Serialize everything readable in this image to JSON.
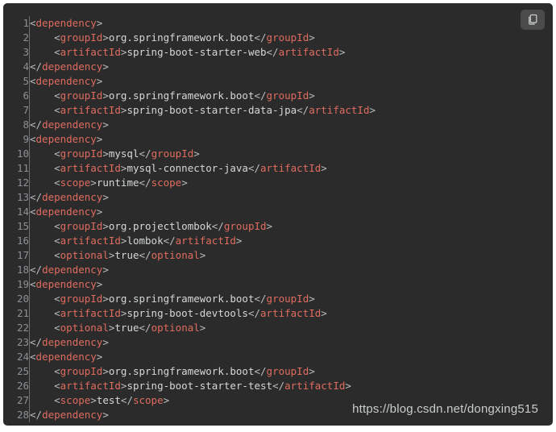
{
  "card": {
    "background_color": "#2b2b2b",
    "gutter_text_color": "#8c9196",
    "tag_color": "#e06c5f",
    "punctuation_color": "#b9bdc0",
    "text_color": "#d4d7d9"
  },
  "copy_button": {
    "label": "",
    "icon": "copy-icon",
    "title": "copy"
  },
  "watermark": {
    "text": "https://blog.csdn.net/dongxing515"
  },
  "code": {
    "language": "xml",
    "lines": [
      {
        "n": "1",
        "indent": 0,
        "tokens": [
          {
            "t": "p",
            "v": "<"
          },
          {
            "t": "tag",
            "v": "dependency"
          },
          {
            "t": "p",
            "v": ">"
          }
        ]
      },
      {
        "n": "2",
        "indent": 1,
        "tokens": [
          {
            "t": "p",
            "v": "<"
          },
          {
            "t": "tag",
            "v": "groupId"
          },
          {
            "t": "p",
            "v": ">"
          },
          {
            "t": "txt",
            "v": "org.springframework.boot"
          },
          {
            "t": "p",
            "v": "</"
          },
          {
            "t": "tag",
            "v": "groupId"
          },
          {
            "t": "p",
            "v": ">"
          }
        ]
      },
      {
        "n": "3",
        "indent": 1,
        "tokens": [
          {
            "t": "p",
            "v": "<"
          },
          {
            "t": "tag",
            "v": "artifactId"
          },
          {
            "t": "p",
            "v": ">"
          },
          {
            "t": "txt",
            "v": "spring-boot-starter-web"
          },
          {
            "t": "p",
            "v": "</"
          },
          {
            "t": "tag",
            "v": "artifactId"
          },
          {
            "t": "p",
            "v": ">"
          }
        ]
      },
      {
        "n": "4",
        "indent": 0,
        "tokens": [
          {
            "t": "p",
            "v": "</"
          },
          {
            "t": "tag",
            "v": "dependency"
          },
          {
            "t": "p",
            "v": ">"
          }
        ]
      },
      {
        "n": "5",
        "indent": 0,
        "tokens": [
          {
            "t": "p",
            "v": "<"
          },
          {
            "t": "tag",
            "v": "dependency"
          },
          {
            "t": "p",
            "v": ">"
          }
        ]
      },
      {
        "n": "6",
        "indent": 1,
        "tokens": [
          {
            "t": "p",
            "v": "<"
          },
          {
            "t": "tag",
            "v": "groupId"
          },
          {
            "t": "p",
            "v": ">"
          },
          {
            "t": "txt",
            "v": "org.springframework.boot"
          },
          {
            "t": "p",
            "v": "</"
          },
          {
            "t": "tag",
            "v": "groupId"
          },
          {
            "t": "p",
            "v": ">"
          }
        ]
      },
      {
        "n": "7",
        "indent": 1,
        "tokens": [
          {
            "t": "p",
            "v": "<"
          },
          {
            "t": "tag",
            "v": "artifactId"
          },
          {
            "t": "p",
            "v": ">"
          },
          {
            "t": "txt",
            "v": "spring-boot-starter-data-jpa"
          },
          {
            "t": "p",
            "v": "</"
          },
          {
            "t": "tag",
            "v": "artifactId"
          },
          {
            "t": "p",
            "v": ">"
          }
        ]
      },
      {
        "n": "8",
        "indent": 0,
        "tokens": [
          {
            "t": "p",
            "v": "</"
          },
          {
            "t": "tag",
            "v": "dependency"
          },
          {
            "t": "p",
            "v": ">"
          }
        ]
      },
      {
        "n": "9",
        "indent": 0,
        "tokens": [
          {
            "t": "p",
            "v": "<"
          },
          {
            "t": "tag",
            "v": "dependency"
          },
          {
            "t": "p",
            "v": ">"
          }
        ]
      },
      {
        "n": "10",
        "indent": 1,
        "tokens": [
          {
            "t": "p",
            "v": "<"
          },
          {
            "t": "tag",
            "v": "groupId"
          },
          {
            "t": "p",
            "v": ">"
          },
          {
            "t": "txt",
            "v": "mysql"
          },
          {
            "t": "p",
            "v": "</"
          },
          {
            "t": "tag",
            "v": "groupId"
          },
          {
            "t": "p",
            "v": ">"
          }
        ]
      },
      {
        "n": "11",
        "indent": 1,
        "tokens": [
          {
            "t": "p",
            "v": "<"
          },
          {
            "t": "tag",
            "v": "artifactId"
          },
          {
            "t": "p",
            "v": ">"
          },
          {
            "t": "txt",
            "v": "mysql-connector-java"
          },
          {
            "t": "p",
            "v": "</"
          },
          {
            "t": "tag",
            "v": "artifactId"
          },
          {
            "t": "p",
            "v": ">"
          }
        ]
      },
      {
        "n": "12",
        "indent": 1,
        "tokens": [
          {
            "t": "p",
            "v": "<"
          },
          {
            "t": "tag",
            "v": "scope"
          },
          {
            "t": "p",
            "v": ">"
          },
          {
            "t": "txt",
            "v": "runtime"
          },
          {
            "t": "p",
            "v": "</"
          },
          {
            "t": "tag",
            "v": "scope"
          },
          {
            "t": "p",
            "v": ">"
          }
        ]
      },
      {
        "n": "13",
        "indent": 0,
        "tokens": [
          {
            "t": "p",
            "v": "</"
          },
          {
            "t": "tag",
            "v": "dependency"
          },
          {
            "t": "p",
            "v": ">"
          }
        ]
      },
      {
        "n": "14",
        "indent": 0,
        "tokens": [
          {
            "t": "p",
            "v": "<"
          },
          {
            "t": "tag",
            "v": "dependency"
          },
          {
            "t": "p",
            "v": ">"
          }
        ]
      },
      {
        "n": "15",
        "indent": 1,
        "tokens": [
          {
            "t": "p",
            "v": "<"
          },
          {
            "t": "tag",
            "v": "groupId"
          },
          {
            "t": "p",
            "v": ">"
          },
          {
            "t": "txt",
            "v": "org.projectlombok"
          },
          {
            "t": "p",
            "v": "</"
          },
          {
            "t": "tag",
            "v": "groupId"
          },
          {
            "t": "p",
            "v": ">"
          }
        ]
      },
      {
        "n": "16",
        "indent": 1,
        "tokens": [
          {
            "t": "p",
            "v": "<"
          },
          {
            "t": "tag",
            "v": "artifactId"
          },
          {
            "t": "p",
            "v": ">"
          },
          {
            "t": "txt",
            "v": "lombok"
          },
          {
            "t": "p",
            "v": "</"
          },
          {
            "t": "tag",
            "v": "artifactId"
          },
          {
            "t": "p",
            "v": ">"
          }
        ]
      },
      {
        "n": "17",
        "indent": 1,
        "tokens": [
          {
            "t": "p",
            "v": "<"
          },
          {
            "t": "tag",
            "v": "optional"
          },
          {
            "t": "p",
            "v": ">"
          },
          {
            "t": "txt",
            "v": "true"
          },
          {
            "t": "p",
            "v": "</"
          },
          {
            "t": "tag",
            "v": "optional"
          },
          {
            "t": "p",
            "v": ">"
          }
        ]
      },
      {
        "n": "18",
        "indent": 0,
        "tokens": [
          {
            "t": "p",
            "v": "</"
          },
          {
            "t": "tag",
            "v": "dependency"
          },
          {
            "t": "p",
            "v": ">"
          }
        ]
      },
      {
        "n": "19",
        "indent": 0,
        "tokens": [
          {
            "t": "p",
            "v": "<"
          },
          {
            "t": "tag",
            "v": "dependency"
          },
          {
            "t": "p",
            "v": ">"
          }
        ]
      },
      {
        "n": "20",
        "indent": 1,
        "tokens": [
          {
            "t": "p",
            "v": "<"
          },
          {
            "t": "tag",
            "v": "groupId"
          },
          {
            "t": "p",
            "v": ">"
          },
          {
            "t": "txt",
            "v": "org.springframework.boot"
          },
          {
            "t": "p",
            "v": "</"
          },
          {
            "t": "tag",
            "v": "groupId"
          },
          {
            "t": "p",
            "v": ">"
          }
        ]
      },
      {
        "n": "21",
        "indent": 1,
        "tokens": [
          {
            "t": "p",
            "v": "<"
          },
          {
            "t": "tag",
            "v": "artifactId"
          },
          {
            "t": "p",
            "v": ">"
          },
          {
            "t": "txt",
            "v": "spring-boot-devtools"
          },
          {
            "t": "p",
            "v": "</"
          },
          {
            "t": "tag",
            "v": "artifactId"
          },
          {
            "t": "p",
            "v": ">"
          }
        ]
      },
      {
        "n": "22",
        "indent": 1,
        "tokens": [
          {
            "t": "p",
            "v": "<"
          },
          {
            "t": "tag",
            "v": "optional"
          },
          {
            "t": "p",
            "v": ">"
          },
          {
            "t": "txt",
            "v": "true"
          },
          {
            "t": "p",
            "v": "</"
          },
          {
            "t": "tag",
            "v": "optional"
          },
          {
            "t": "p",
            "v": ">"
          }
        ]
      },
      {
        "n": "23",
        "indent": 0,
        "tokens": [
          {
            "t": "p",
            "v": "</"
          },
          {
            "t": "tag",
            "v": "dependency"
          },
          {
            "t": "p",
            "v": ">"
          }
        ]
      },
      {
        "n": "24",
        "indent": 0,
        "tokens": [
          {
            "t": "p",
            "v": "<"
          },
          {
            "t": "tag",
            "v": "dependency"
          },
          {
            "t": "p",
            "v": ">"
          }
        ]
      },
      {
        "n": "25",
        "indent": 1,
        "tokens": [
          {
            "t": "p",
            "v": "<"
          },
          {
            "t": "tag",
            "v": "groupId"
          },
          {
            "t": "p",
            "v": ">"
          },
          {
            "t": "txt",
            "v": "org.springframework.boot"
          },
          {
            "t": "p",
            "v": "</"
          },
          {
            "t": "tag",
            "v": "groupId"
          },
          {
            "t": "p",
            "v": ">"
          }
        ]
      },
      {
        "n": "26",
        "indent": 1,
        "tokens": [
          {
            "t": "p",
            "v": "<"
          },
          {
            "t": "tag",
            "v": "artifactId"
          },
          {
            "t": "p",
            "v": ">"
          },
          {
            "t": "txt",
            "v": "spring-boot-starter-test"
          },
          {
            "t": "p",
            "v": "</"
          },
          {
            "t": "tag",
            "v": "artifactId"
          },
          {
            "t": "p",
            "v": ">"
          }
        ]
      },
      {
        "n": "27",
        "indent": 1,
        "tokens": [
          {
            "t": "p",
            "v": "<"
          },
          {
            "t": "tag",
            "v": "scope"
          },
          {
            "t": "p",
            "v": ">"
          },
          {
            "t": "txt",
            "v": "test"
          },
          {
            "t": "p",
            "v": "</"
          },
          {
            "t": "tag",
            "v": "scope"
          },
          {
            "t": "p",
            "v": ">"
          }
        ]
      },
      {
        "n": "28",
        "indent": 0,
        "tokens": [
          {
            "t": "p",
            "v": "</"
          },
          {
            "t": "tag",
            "v": "dependency"
          },
          {
            "t": "p",
            "v": ">"
          }
        ]
      }
    ]
  }
}
